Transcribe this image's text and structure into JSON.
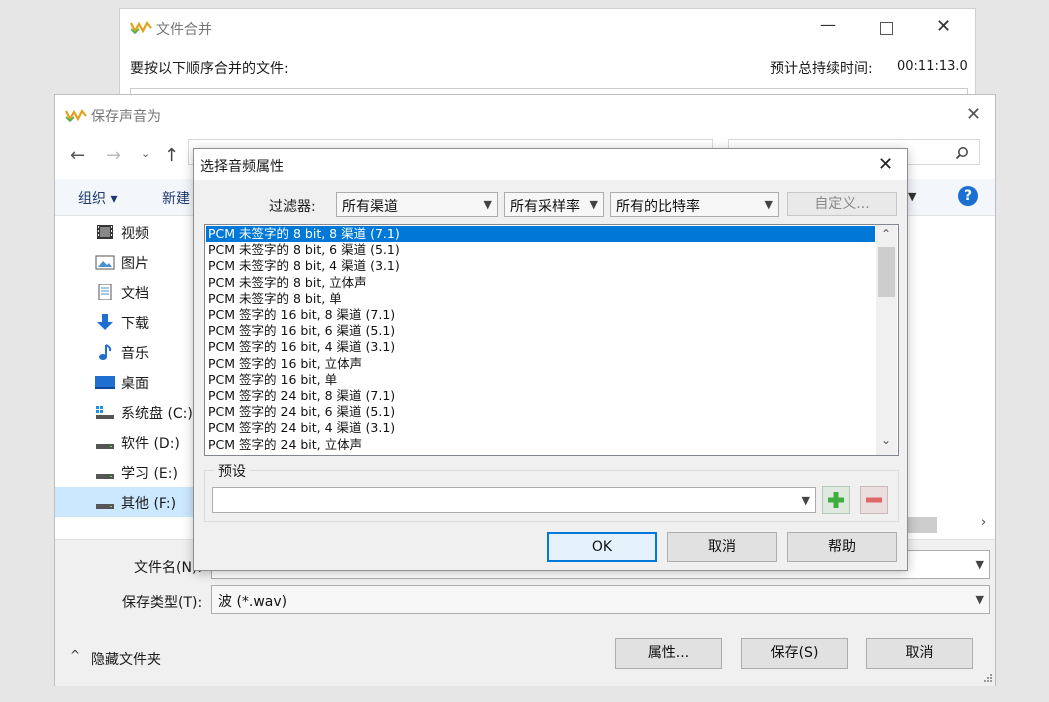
{
  "merge_window": {
    "title": "文件合并",
    "instruction": "要按以下顺序合并的文件:",
    "duration_label": "预计总持续时间:",
    "duration_value": "00:11:13.0"
  },
  "save_window": {
    "title": "保存声音为",
    "toolbar": {
      "organize": "组织 ▾",
      "new_folder": "新建"
    },
    "nav_items": [
      {
        "label": "视频",
        "icon": "video-icon"
      },
      {
        "label": "图片",
        "icon": "pictures-icon"
      },
      {
        "label": "文档",
        "icon": "documents-icon"
      },
      {
        "label": "下载",
        "icon": "download-icon"
      },
      {
        "label": "音乐",
        "icon": "music-icon"
      },
      {
        "label": "桌面",
        "icon": "desktop-icon"
      },
      {
        "label": "系统盘 (C:)",
        "icon": "system-drive-icon"
      },
      {
        "label": "软件 (D:)",
        "icon": "drive-icon"
      },
      {
        "label": "学习 (E:)",
        "icon": "drive-icon"
      },
      {
        "label": "其他 (F:)",
        "icon": "drive-icon",
        "selected": true
      }
    ],
    "filename_label": "文件名(N):",
    "filetype_label": "保存类型(T):",
    "filetype_value": "波 (*.wav)",
    "hide_folders": "隐藏文件夹",
    "buttons": {
      "properties": "属性...",
      "save": "保存(S)",
      "cancel": "取消"
    }
  },
  "audio_dialog": {
    "title": "选择音频属性",
    "filter_label": "过滤器:",
    "filters": {
      "channels": "所有渠道",
      "sample_rate": "所有采样率",
      "bitrate": "所有的比特率"
    },
    "custom_button": "自定义...",
    "formats": [
      "PCM 未签字的 8 bit, 8 渠道 (7.1)",
      "PCM 未签字的 8 bit, 6 渠道 (5.1)",
      "PCM 未签字的 8 bit, 4 渠道 (3.1)",
      "PCM 未签字的 8 bit, 立体声",
      "PCM 未签字的 8 bit, 单",
      "PCM 签字的 16 bit, 8 渠道 (7.1)",
      "PCM 签字的 16 bit, 6 渠道 (5.1)",
      "PCM 签字的 16 bit, 4 渠道 (3.1)",
      "PCM 签字的 16 bit, 立体声",
      "PCM 签字的 16 bit, 单",
      "PCM 签字的 24 bit, 8 渠道 (7.1)",
      "PCM 签字的 24 bit, 6 渠道 (5.1)",
      "PCM 签字的 24 bit, 4 渠道 (3.1)",
      "PCM 签字的 24 bit, 立体声"
    ],
    "preset_label": "预设",
    "preset_value": "",
    "buttons": {
      "ok": "OK",
      "cancel": "取消",
      "help": "帮助"
    }
  }
}
